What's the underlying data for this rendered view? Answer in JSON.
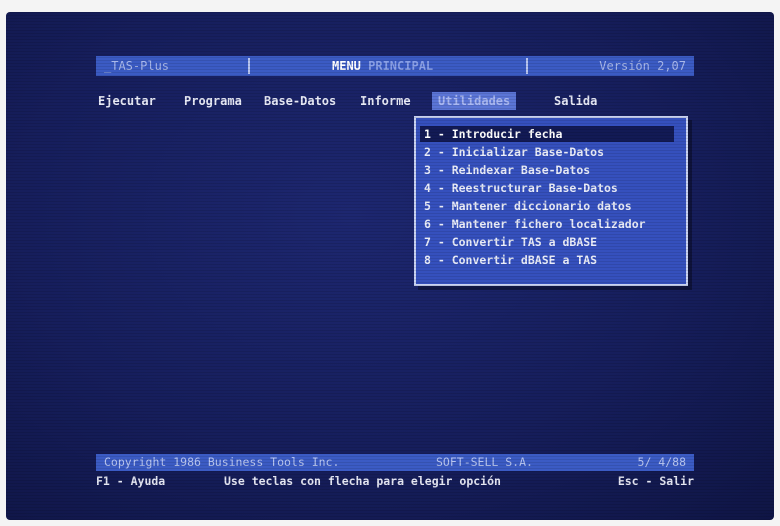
{
  "colors": {
    "screen_background": "#161e5c",
    "bar_background": "#3b5bc4",
    "text": "#e6e8f4",
    "selection_background": "#121a55",
    "dropdown_border": "#c9d2f2"
  },
  "title_bar": {
    "app_name": "_TAS-Plus",
    "menu_title_bright": "MENU ",
    "menu_title_dim": "PRINCIPAL",
    "version": "Versión 2,07"
  },
  "menubar": {
    "items": [
      {
        "label": "Ejecutar"
      },
      {
        "label": "Programa"
      },
      {
        "label": "Base-Datos"
      },
      {
        "label": "Informe"
      },
      {
        "label": "Utilidades",
        "active": true
      },
      {
        "label": "Salida"
      }
    ]
  },
  "utilidades_menu": {
    "options": [
      {
        "label": "1 - Introducir fecha",
        "selected": true
      },
      {
        "label": "2 - Inicializar Base-Datos"
      },
      {
        "label": "3 - Reindexar Base-Datos"
      },
      {
        "label": "4 - Reestructurar Base-Datos"
      },
      {
        "label": "5 - Mantener diccionario datos"
      },
      {
        "label": "6 - Mantener fichero localizador"
      },
      {
        "label": "7 - Convertir TAS a dBASE"
      },
      {
        "label": "8 - Convertir dBASE a TAS"
      }
    ]
  },
  "status_bar": {
    "copyright": "Copyright 1986 Business Tools Inc.",
    "distributor": "SOFT-SELL S.A.",
    "date": "5/ 4/88"
  },
  "help_line": {
    "help_key": "F1 - Ayuda",
    "instruction": "Use teclas con flecha para elegir opción",
    "exit_key": "Esc - Salir"
  }
}
